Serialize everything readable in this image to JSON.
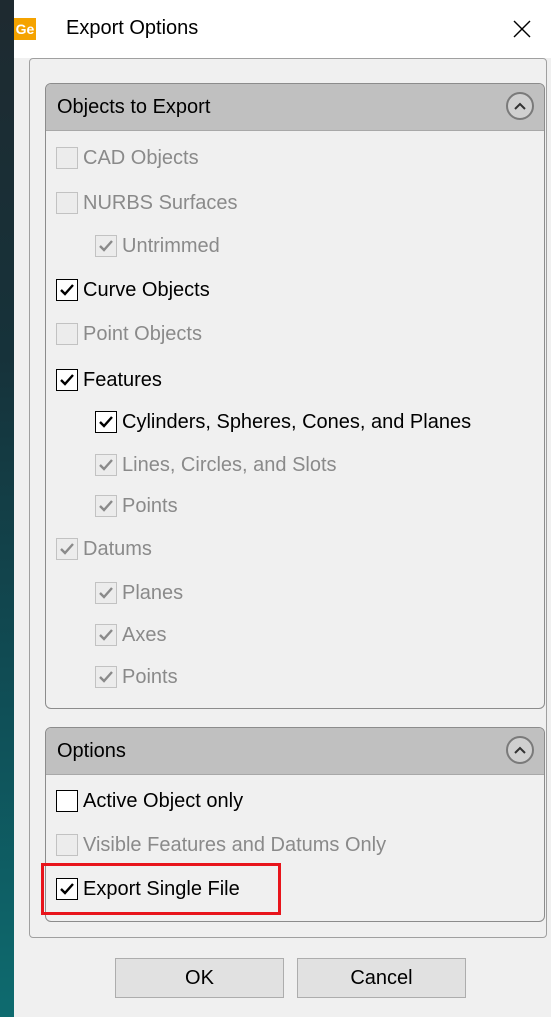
{
  "window": {
    "title": "Export Options",
    "logo_text": "Ge"
  },
  "objects_group": {
    "header": "Objects to Export",
    "items": [
      {
        "label": "CAD Objects",
        "checked": false,
        "enabled": false,
        "indent": 0
      },
      {
        "label": "NURBS Surfaces",
        "checked": false,
        "enabled": false,
        "indent": 0
      },
      {
        "label": "Untrimmed",
        "checked": true,
        "enabled": false,
        "indent": 1
      },
      {
        "label": "Curve Objects",
        "checked": true,
        "enabled": true,
        "indent": 0
      },
      {
        "label": "Point Objects",
        "checked": false,
        "enabled": false,
        "indent": 0
      },
      {
        "label": "Features",
        "checked": true,
        "enabled": true,
        "indent": 0
      },
      {
        "label": "Cylinders, Spheres, Cones, and Planes",
        "checked": true,
        "enabled": true,
        "indent": 1
      },
      {
        "label": "Lines, Circles, and Slots",
        "checked": true,
        "enabled": false,
        "indent": 1
      },
      {
        "label": "Points",
        "checked": true,
        "enabled": false,
        "indent": 1
      },
      {
        "label": "Datums",
        "checked": true,
        "enabled": false,
        "indent": 0
      },
      {
        "label": "Planes",
        "checked": true,
        "enabled": false,
        "indent": 1
      },
      {
        "label": "Axes",
        "checked": true,
        "enabled": false,
        "indent": 1
      },
      {
        "label": "Points",
        "checked": true,
        "enabled": false,
        "indent": 1
      }
    ]
  },
  "options_group": {
    "header": "Options",
    "items": [
      {
        "label": "Active Object only",
        "checked": false,
        "enabled": true,
        "indent": 0
      },
      {
        "label": "Visible Features and Datums Only",
        "checked": false,
        "enabled": false,
        "indent": 0
      },
      {
        "label": "Export Single File",
        "checked": true,
        "enabled": true,
        "indent": 0,
        "highlighted": true
      }
    ]
  },
  "buttons": {
    "ok": "OK",
    "cancel": "Cancel"
  },
  "colors": {
    "highlight": "#e8141b",
    "group_header": "#c0c0c0",
    "dialog_bg": "#f0f0f0"
  }
}
